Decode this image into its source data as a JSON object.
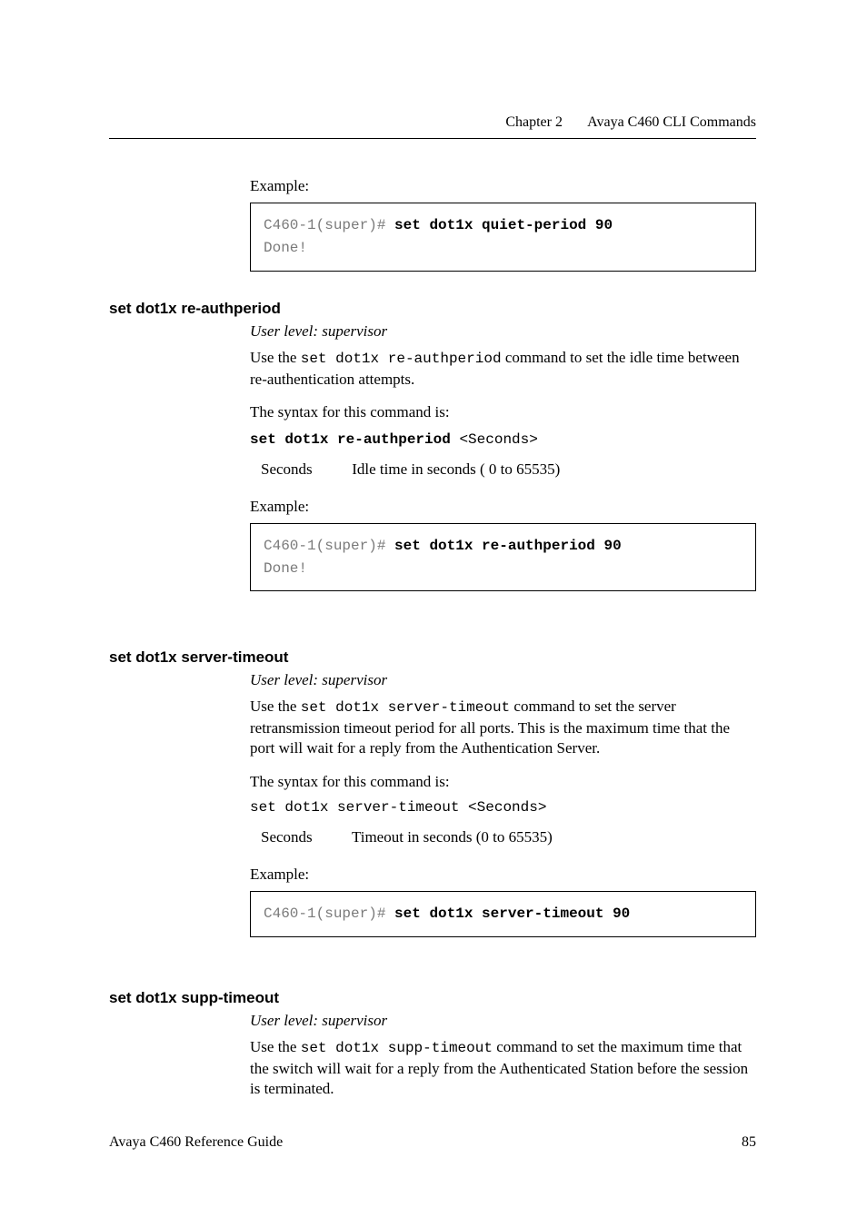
{
  "header": {
    "chapter": "Chapter 2",
    "title": "Avaya C460 CLI Commands"
  },
  "s1": {
    "exampleLabel": "Example:",
    "code_prompt": "C460-1(super)# ",
    "code_cmd": "set dot1x quiet-period 90",
    "code_out": "Done!"
  },
  "s2": {
    "heading": "set dot1x re-authperiod",
    "userlevel": "User level: supervisor",
    "intro_a": "Use the ",
    "intro_mono": "set dot1x re-authperiod",
    "intro_b": " command to set the idle time between re-authentication attempts.",
    "syntax_intro": "The syntax for this command is:",
    "syntax_cmd": "set dot1x re-authperiod",
    "syntax_arg": " <Seconds>",
    "param_name": "Seconds",
    "param_desc": "Idle time in seconds ( 0 to 65535)",
    "exampleLabel": "Example:",
    "code_prompt": "C460-1(super)# ",
    "code_cmd": "set dot1x re-authperiod 90",
    "code_out": "Done!"
  },
  "s3": {
    "heading": "set dot1x server-timeout",
    "userlevel": "User level: supervisor",
    "intro_a": "Use the ",
    "intro_mono": "set dot1x server-timeout",
    "intro_b": " command to set the server retransmission timeout period for all ports. This is the maximum time that the port will wait for a reply from the Authentication Server.",
    "syntax_intro": "The syntax for this command is:",
    "syntax_line": "set dot1x server-timeout <Seconds>",
    "param_name": "Seconds",
    "param_desc": "Timeout in seconds (0 to 65535)",
    "exampleLabel": "Example:",
    "code_prompt": "C460-1(super)# ",
    "code_cmd": "set dot1x server-timeout 90"
  },
  "s4": {
    "heading": "set dot1x supp-timeout",
    "userlevel": "User level: supervisor",
    "intro_a": "Use the ",
    "intro_mono": "set dot1x supp-timeout",
    "intro_b": " command to set the maximum time that the switch will wait for a reply from the Authenticated Station before the session is terminated."
  },
  "footer": {
    "left": "Avaya C460 Reference Guide",
    "right": "85"
  }
}
